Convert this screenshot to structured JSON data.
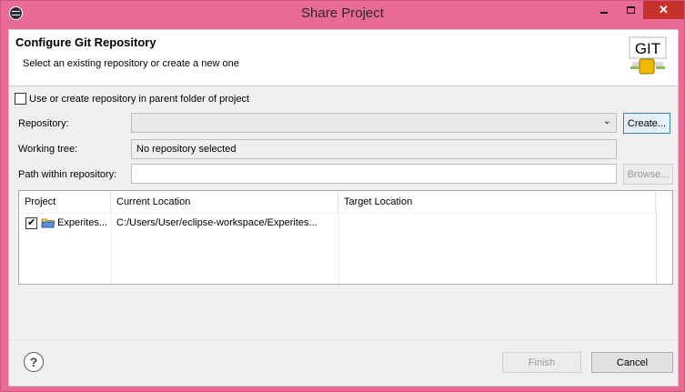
{
  "window": {
    "title": "Share Project",
    "controls": {
      "minimize": "minimize-icon",
      "maximize": "maximize-icon",
      "close": "✕"
    }
  },
  "header": {
    "title": "Configure Git Repository",
    "subtitle": "Select an existing repository or create a new one",
    "logo_text": "GIT"
  },
  "parent_repo_checkbox": {
    "label": "Use or create repository in parent folder of project",
    "checked": false
  },
  "form": {
    "repository_label": "Repository:",
    "repository_value": "",
    "create_button": "Create...",
    "working_tree_label": "Working tree:",
    "working_tree_value": "No repository selected",
    "path_label": "Path within repository:",
    "path_value": "",
    "browse_button": "Browse..."
  },
  "table": {
    "columns": [
      "Project",
      "Current Location",
      "Target Location"
    ],
    "rows": [
      {
        "checked": true,
        "project": "Experites...",
        "current_location": "C:/Users/User/eclipse-workspace/Experites...",
        "target_location": ""
      }
    ]
  },
  "footer": {
    "help_icon": "?",
    "finish_button": "Finish",
    "cancel_button": "Cancel"
  },
  "colors": {
    "titlebar": "#e86a97",
    "close_button": "#c7312b",
    "dialog_bg": "#f0f0f0"
  }
}
